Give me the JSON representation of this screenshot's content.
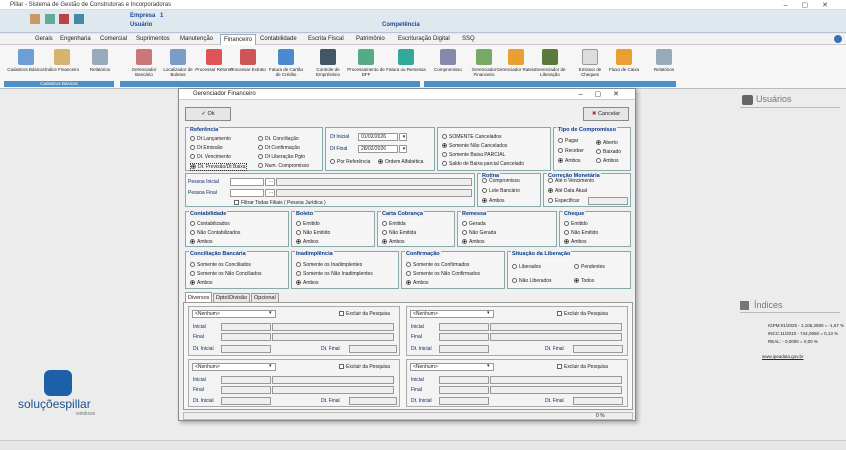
{
  "app": {
    "title": "Pillar - Sistema de Gestão de Construtoras e Incorporadoras"
  },
  "info": {
    "empresa_label": "Empresa",
    "empresa_val": "1",
    "usuario_label": "Usuário",
    "competencia_label": "Competência"
  },
  "menu": [
    "Gerais",
    "Engenharia",
    "Comercial",
    "Suprimentos",
    "Manutenção",
    "Financeiro",
    "Contabilidade",
    "Escrita Fiscal",
    "Patrimônio",
    "Escrituração Digital",
    "SSQ"
  ],
  "ribbon": {
    "buttons": [
      "Cadastros Básicos",
      "Índice Financeiro",
      "Relatórios",
      "Gerenciador Bancário",
      "Localizador de Boletos",
      "Processar Retorno",
      "Processar Extrato",
      "Fatura de Cartão de Crédito",
      "Controle de Empréstimo",
      "Processamento de DFF",
      "Fatura ou Remessa",
      "Compromisso",
      "Gerenciador Financeiro",
      "Gerenciador Rateio",
      "Gerenciador de Liberação",
      "Emissor de Cheques",
      "Fluxo de Caixa",
      "Relatórios"
    ],
    "group1": "Cadastros Básicos"
  },
  "dialog": {
    "title": "Gerenciador Financeiro",
    "ok": "Ok",
    "cancel": "Cancelar",
    "referencia": {
      "title": "Referência",
      "opts": [
        "Dt Lançamento",
        "Dt Emissão",
        "Dt. Vencimento",
        "Dt. Previsão/Dt Baixa",
        "Dt. Conciliação",
        "Dt Confirmação",
        "Dt Liberação Pgto",
        "Num. Compromisso"
      ]
    },
    "dt_inicial_label": "Dt Inicial",
    "dt_inicial": "01/02/2026",
    "dt_final_label": "Dt Final",
    "dt_final": "28/02/2026",
    "ordem": [
      "Por Referência",
      "Ordem Alfabética"
    ],
    "status": [
      "SOMENTE Cancelados",
      "Somente Não Cancelados",
      "Somente Baixa PARCIAL",
      "Saldo de Baixa parcial Cancelado"
    ],
    "tipo": {
      "title": "Tipo de Compromisso",
      "opts": [
        "Pagar",
        "Receber",
        "Ambos"
      ],
      "opts2": [
        "Aberto",
        "Baixado",
        "Ambos"
      ]
    },
    "pessoa_inicial": "Pessoa Inicial",
    "pessoa_final": "Pessoa Final",
    "filiais": "Filtrar Todas Filiais ( Pessoa Jurídica )",
    "rotina": {
      "title": "Rotina",
      "opts": [
        "Compromisso",
        "Lote Bancário",
        "Ambos"
      ]
    },
    "correcao": {
      "title": "Correção Monetária",
      "opts": [
        "Até o Vencimento",
        "Até Data Atual",
        "Especificar"
      ]
    },
    "contabilidade": {
      "title": "Contabilidade",
      "opts": [
        "Contabilizados",
        "Não Contabilizados",
        "Ambos"
      ]
    },
    "boleto": {
      "title": "Boleto",
      "opts": [
        "Emitido",
        "Não Emitido",
        "Ambos"
      ]
    },
    "carta": {
      "title": "Carta Cobrança",
      "opts": [
        "Emitida",
        "Não Emitida",
        "Ambos"
      ]
    },
    "remessa": {
      "title": "Remessa",
      "opts": [
        "Gerada",
        "Não Gerada",
        "Ambos"
      ]
    },
    "cheque": {
      "title": "Cheque",
      "opts": [
        "Emitido",
        "Não Emitido",
        "Ambos"
      ]
    },
    "conciliacao": {
      "title": "Conciliação Bancária",
      "opts": [
        "Somente os Conciliados",
        "Somente os Não Conciliados",
        "Ambos"
      ]
    },
    "inadimplencia": {
      "title": "Inadimplência",
      "opts": [
        "Somente os Inadimplentes",
        "Somente os Não Inadimplentes",
        "Ambos"
      ]
    },
    "confirmacao": {
      "title": "Confirmação",
      "opts": [
        "Somente os Confirmados",
        "Somente os Não Confirmados",
        "Ambos"
      ]
    },
    "liberacao": {
      "title": "Situação da Liberação",
      "opts": [
        "Liberados",
        "Pendentes",
        "Não Liberados",
        "Todos"
      ]
    },
    "tabs": [
      "Diversos",
      "Dpto\\Divisão",
      "Opcional"
    ],
    "panel": {
      "select": "<Nenhum>",
      "excluir": "Excluir da Pesquisa",
      "inicial": "Inicial",
      "final": "Final",
      "dt_inicial": "Dt. Inicial",
      "dt_final": "Dt. Final"
    },
    "status_pct": "0 %"
  },
  "side": {
    "usuarios": "Usuários",
    "indices": "Índices",
    "idx_lines": [
      "IGPM:01/2025 - 1.106,2590 = -1,67 %",
      "INCC:11/2010 - 744,0650 = 0,13 %",
      "REAL: - 0,0000 = 0,00 %"
    ],
    "link": "www.ipeadata.gov.br",
    "logo_line1": "soluçõespillar",
    "logo_line2": "windows"
  }
}
